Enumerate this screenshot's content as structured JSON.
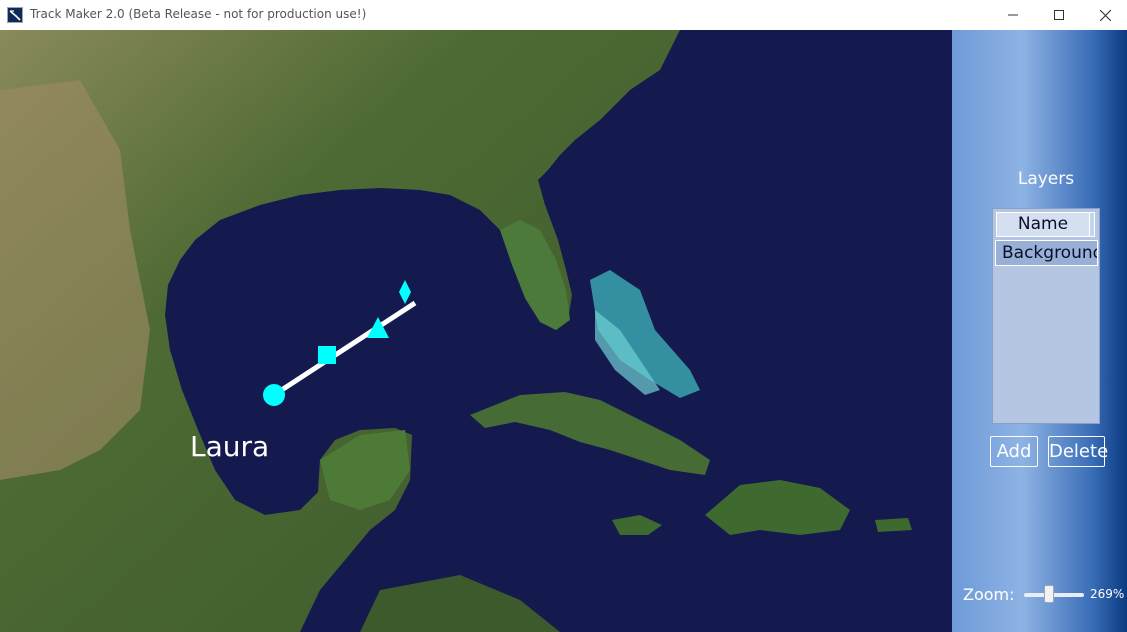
{
  "window": {
    "title": "Track Maker 2.0 (Beta Release - not for production use!)"
  },
  "map": {
    "storm_name": "Laura",
    "track_point_icons": [
      "circle-icon",
      "square-icon",
      "triangle-icon",
      "diamond-icon"
    ],
    "track_color": "#00ffff",
    "line_color": "#ffffff"
  },
  "panel": {
    "layers_title": "Layers",
    "column_header": "Name",
    "layers": [
      "Background"
    ],
    "add_label": "Add",
    "delete_label": "Delete",
    "zoom_label": "Zoom:",
    "zoom_value": "269%",
    "zoom_level_percent": 269
  }
}
